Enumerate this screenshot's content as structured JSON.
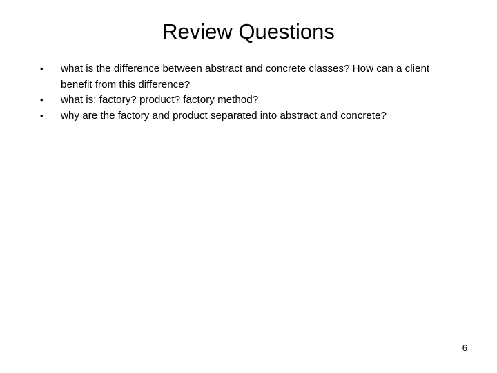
{
  "slide": {
    "title": "Review Questions",
    "bullets": [
      {
        "marker": "•",
        "text": "what is the difference between abstract and concrete classes? How can a client benefit from this difference?"
      },
      {
        "marker": "•",
        "text": "what is: factory? product? factory method?"
      },
      {
        "marker": "•",
        "text": "why are the factory and product separated into abstract and concrete?"
      }
    ],
    "page_number": "6"
  }
}
